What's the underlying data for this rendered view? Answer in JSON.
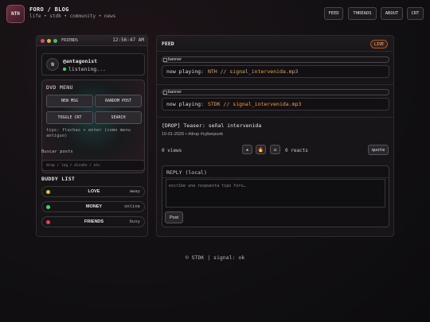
{
  "header": {
    "logo": "NTH",
    "title": "FORO / BLOG",
    "subtitle": "life • stdk • community • news",
    "nav": [
      "FEED",
      "THREADS",
      "ABOUT",
      "CRT"
    ]
  },
  "sidebar": {
    "window_label": "FRIENDS",
    "clock": "12:56:47 AM",
    "profile": {
      "avatar": "N",
      "handle": "@antagonist",
      "status": "listening..."
    },
    "dvd_menu": {
      "title": "DVD MENU",
      "buttons": [
        "NEW MSG",
        "RANDOM POST",
        "TOGGLE CRT",
        "SEARCH"
      ],
      "tips": "tips: flechas + enter (como menu antiguo)"
    },
    "search": {
      "label": "Buscar posts",
      "placeholder": "drop / log / diseño / etc"
    },
    "buddy_list": {
      "title": "BUDDY LIST",
      "items": [
        {
          "name": "LOVE",
          "state": "away",
          "color": "#e0c040"
        },
        {
          "name": "MONEY",
          "state": "online",
          "color": "#45d36b"
        },
        {
          "name": "FRIENDS",
          "state": "busy",
          "color": "#e04848"
        }
      ]
    }
  },
  "feed": {
    "title": "FEED",
    "live": "LIVE",
    "now_playing": [
      {
        "banner_alt": "banner",
        "label": "now playing:",
        "track": "NTH // signal_intervenida.mp3"
      },
      {
        "banner_alt": "banner",
        "label": "now playing:",
        "track": "STDK // signal_intervenida.mp3"
      }
    ],
    "post": {
      "title": "[DROP] Teaser: señal intervenida",
      "meta": "10-01-2026 • #drop #cyberpunk",
      "views": "0 views",
      "reactions": [
        "★",
        "🔥",
        "☠"
      ],
      "reacts": "0 reacts",
      "quote": "quote"
    },
    "reply": {
      "title": "REPLY (local)",
      "placeholder": "escribe una respuesta tipo foro…",
      "post_button": "Post"
    }
  },
  "footer": "© STDK | signal: ok",
  "colors": {
    "accent": "#f0a040",
    "online": "#45d36b",
    "away": "#e0c040",
    "busy": "#e04848"
  }
}
